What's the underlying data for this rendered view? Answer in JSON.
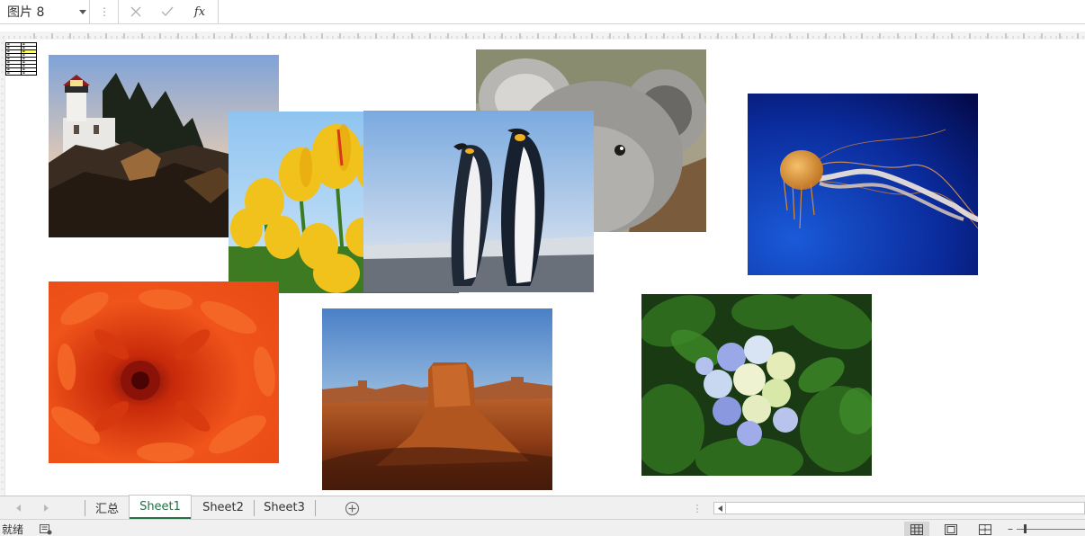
{
  "formula_bar": {
    "name_box_value": "图片 8",
    "formula_value": "",
    "insert_function_label": "fx"
  },
  "sheet_tabs": {
    "tabs": [
      {
        "label": "汇总",
        "active": false
      },
      {
        "label": "Sheet1",
        "active": true
      },
      {
        "label": "Sheet2",
        "active": false
      },
      {
        "label": "Sheet3",
        "active": false
      }
    ]
  },
  "status_bar": {
    "ready_label": "就绪"
  },
  "colors": {
    "active_tab": "#217346",
    "tab_bar_bg": "#f0f0f0",
    "grid_line": "#d4d4d4"
  },
  "icons": {
    "name_box_arrow": "chevron-down-icon",
    "cancel": "close-icon",
    "enter": "check-icon",
    "add_sheet": "plus-circle-icon",
    "macro": "macro-record-icon",
    "view_normal": "grid-view-icon",
    "view_page_layout": "page-layout-icon",
    "view_page_break": "page-break-icon"
  },
  "pictures": [
    {
      "name": "lighthouse"
    },
    {
      "name": "koala"
    },
    {
      "name": "jellyfish"
    },
    {
      "name": "tulips"
    },
    {
      "name": "penguins"
    },
    {
      "name": "chrysanthemum"
    },
    {
      "name": "desert"
    },
    {
      "name": "hydrangeas"
    }
  ]
}
